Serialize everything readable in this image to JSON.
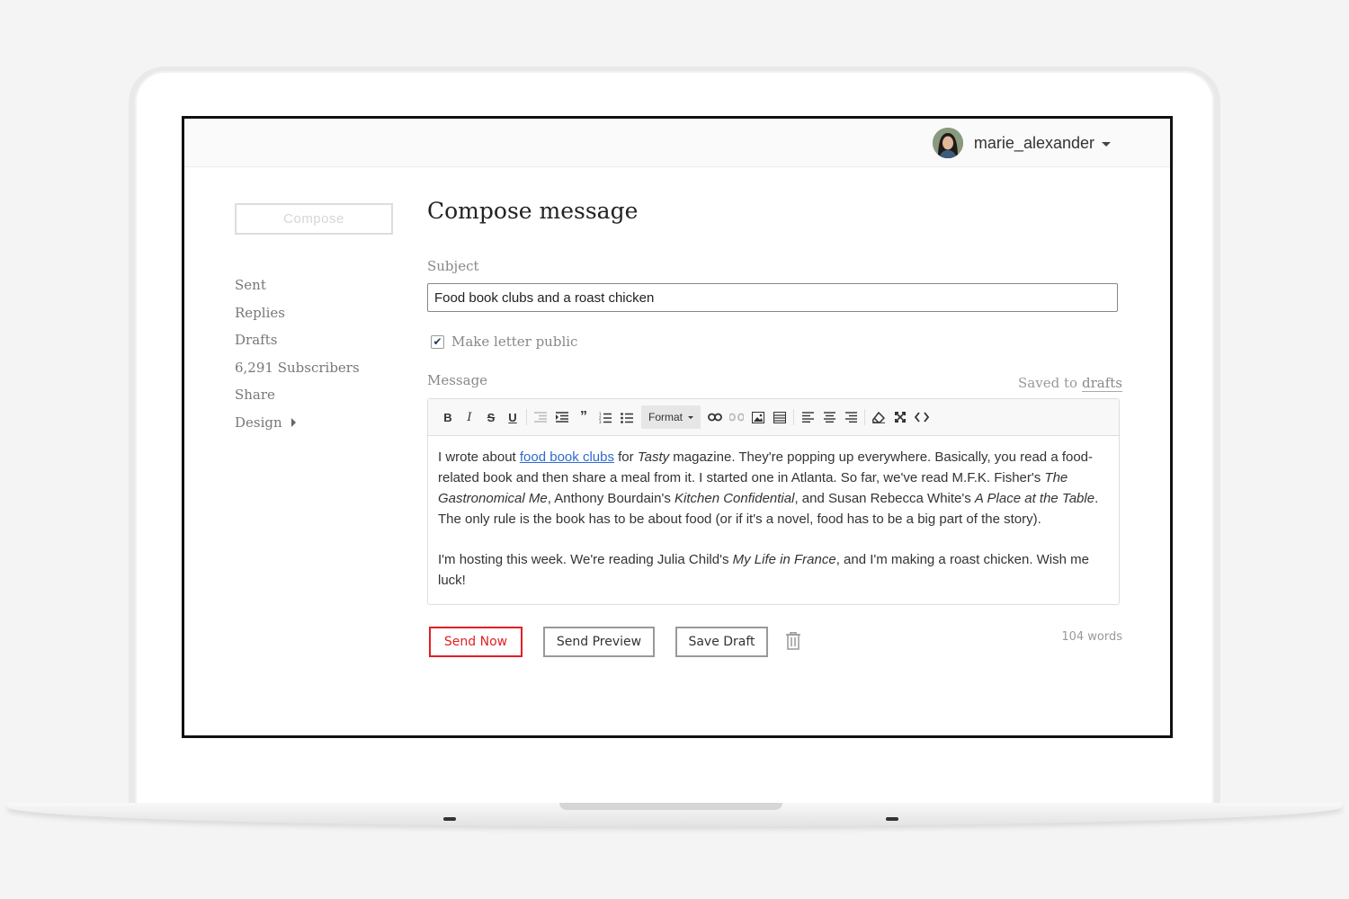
{
  "header": {
    "username": "marie_alexander"
  },
  "sidebar": {
    "compose_label": "Compose",
    "items": [
      {
        "label": "Sent"
      },
      {
        "label": "Replies"
      },
      {
        "label": "Drafts"
      },
      {
        "label": "6,291 Subscribers"
      },
      {
        "label": "Share"
      },
      {
        "label": "Design"
      }
    ]
  },
  "main": {
    "title": "Compose message",
    "subject_label": "Subject",
    "subject_value": "Food book clubs and a roast chicken",
    "public_checkbox": {
      "label": "Make letter public",
      "checked": true
    },
    "message_label": "Message",
    "saved_prefix": "Saved to",
    "saved_link": "drafts",
    "toolbar": {
      "format_label": "Format",
      "icons": [
        "bold-icon",
        "italic-icon",
        "strikethrough-icon",
        "underline-icon",
        "outdent-icon",
        "indent-icon",
        "blockquote-icon",
        "numbered-list-icon",
        "bulleted-list-icon",
        "link-icon",
        "unlink-icon",
        "image-icon",
        "table-icon",
        "align-left-icon",
        "align-center-icon",
        "align-right-icon",
        "clear-format-icon",
        "fullscreen-icon",
        "source-code-icon"
      ]
    },
    "message": {
      "p1_a": "I wrote about ",
      "p1_link": "food book clubs",
      "p1_b": " for ",
      "p1_i1": "Tasty",
      "p1_c": " magazine. They're popping up everywhere. Basically, you read a food-related book and then share a meal from it. I started one in Atlanta. So far, we've read M.F.K. Fisher's ",
      "p1_i2": "The Gastronomical Me",
      "p1_d": ", Anthony Bourdain's ",
      "p1_i3": "Kitchen Confidential",
      "p1_e": ", and Susan Rebecca White's ",
      "p1_i4": "A Place at the Table",
      "p1_f": ". The only rule is the book has to be about food (or if it's a novel, food has to be a big part of the story).",
      "p2_a": "I'm hosting this week. We're reading Julia Child's ",
      "p2_i1": "My Life in France",
      "p2_b": ", and I'm making a roast chicken. Wish me luck!"
    },
    "buttons": {
      "send_now": "Send Now",
      "send_preview": "Send Preview",
      "save_draft": "Save Draft"
    },
    "word_count": "104 words"
  },
  "colors": {
    "accent": "#e21f26",
    "link": "#2f6ad0"
  }
}
